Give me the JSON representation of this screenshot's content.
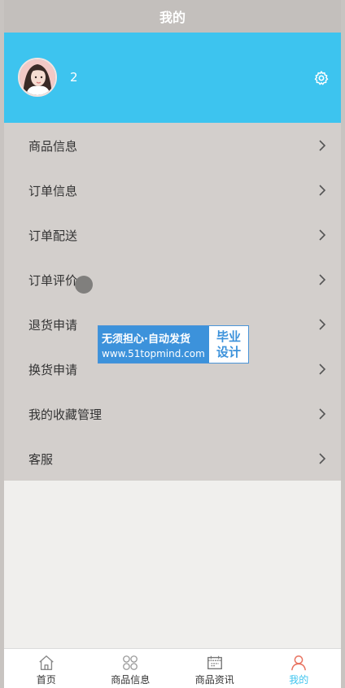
{
  "header": {
    "title": "我的"
  },
  "profile": {
    "username": "2",
    "settings_icon": "gear-icon"
  },
  "menu": {
    "items": [
      {
        "label": "商品信息"
      },
      {
        "label": "订单信息"
      },
      {
        "label": "订单配送"
      },
      {
        "label": "订单评价"
      },
      {
        "label": "退货申请"
      },
      {
        "label": "换货申请"
      },
      {
        "label": "我的收藏管理"
      },
      {
        "label": "客服"
      }
    ]
  },
  "watermark": {
    "line1": "无须担心·自动发货",
    "line2": "www.51topmind.com",
    "right_top": "毕业",
    "right_bottom": "设计"
  },
  "tabbar": {
    "tabs": [
      {
        "label": "首页",
        "icon": "home-icon"
      },
      {
        "label": "商品信息",
        "icon": "grid-icon"
      },
      {
        "label": "商品资讯",
        "icon": "news-icon"
      },
      {
        "label": "我的",
        "icon": "user-icon",
        "active": true
      }
    ]
  },
  "colors": {
    "accent": "#3dc4ef",
    "topbar": "#c3bfbc",
    "menu_bg": "#d3cfcc",
    "watermark_blue": "#3c92db"
  }
}
